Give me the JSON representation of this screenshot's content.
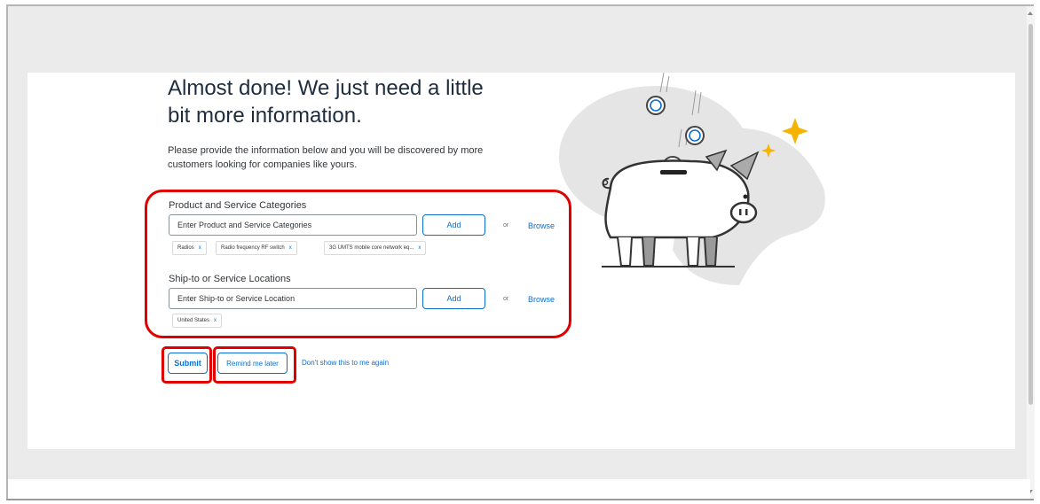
{
  "heading": "Almost done! We just need a little bit more information.",
  "intro_text": "Please provide the information below and you will be discovered by more customers looking for companies like yours.",
  "categories": {
    "label": "Product and Service Categories",
    "placeholder": "Enter Product and Service Categories",
    "add_label": "Add",
    "or_text": "or",
    "browse_label": "Browse",
    "chips": [
      "Radios",
      "Radio frequency RF switch",
      "3G UMTS mobile core network eq..."
    ],
    "remove_symbol": "x"
  },
  "locations": {
    "label": "Ship-to or Service Locations",
    "placeholder": "Enter Ship-to or Service Location",
    "add_label": "Add",
    "or_text": "or",
    "browse_label": "Browse",
    "chips": [
      "United States"
    ],
    "remove_symbol": "x"
  },
  "actions": {
    "submit_label": "Submit",
    "remind_label": "Remind me later",
    "dont_show_label": "Don't show this to me again"
  },
  "illustration": {
    "icon": "piggy-bank-coins-illustration"
  },
  "colors": {
    "accent": "#0a6ed1",
    "highlight": "#e00000",
    "sparkle": "#f5b400",
    "page_background": "#ebebeb"
  }
}
